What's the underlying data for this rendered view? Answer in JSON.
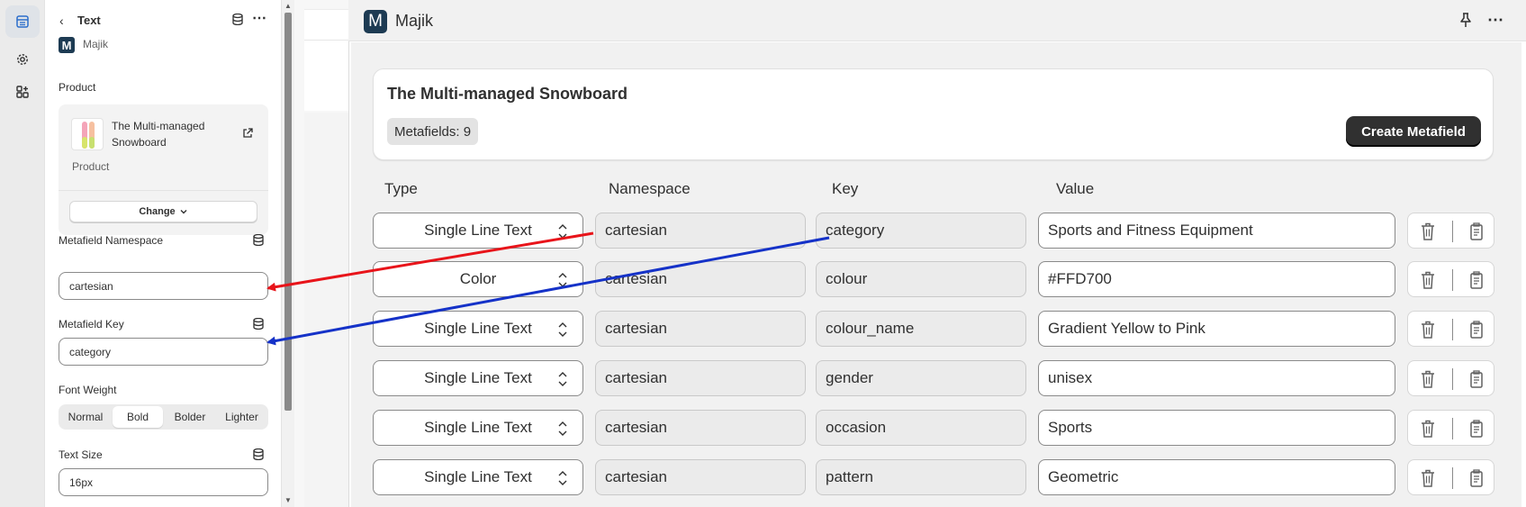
{
  "panel": {
    "back_glyph": "‹",
    "title": "Text",
    "app_logo_letter": "M",
    "app_name": "Majik",
    "product_label": "Product",
    "product_name": "The Multi-managed Snowboard",
    "product_type": "Product",
    "change_label": "Change",
    "namespace_label": "Metafield Namespace",
    "namespace_value": "cartesian",
    "key_label": "Metafield Key",
    "key_value": "category",
    "font_weight_label": "Font Weight",
    "font_weights": [
      "Normal",
      "Bold",
      "Bolder",
      "Lighter"
    ],
    "font_weight_selected": "Bold",
    "text_size_label": "Text Size",
    "text_size_value": "16px"
  },
  "app": {
    "logo_letter": "M",
    "name": "Majik",
    "card_title": "The Multi-managed Snowboard",
    "metafields_badge": "Metafields: 9",
    "create_button": "Create Metafield",
    "columns": [
      "Type",
      "Namespace",
      "Key",
      "Value"
    ],
    "rows": [
      {
        "type": "Single Line Text",
        "namespace": "cartesian",
        "key": "category",
        "value": "Sports and Fitness Equipment"
      },
      {
        "type": "Color",
        "namespace": "cartesian",
        "key": "colour",
        "value": "#FFD700"
      },
      {
        "type": "Single Line Text",
        "namespace": "cartesian",
        "key": "colour_name",
        "value": "Gradient Yellow to Pink"
      },
      {
        "type": "Single Line Text",
        "namespace": "cartesian",
        "key": "gender",
        "value": "unisex"
      },
      {
        "type": "Single Line Text",
        "namespace": "cartesian",
        "key": "occasion",
        "value": "Sports"
      },
      {
        "type": "Single Line Text",
        "namespace": "cartesian",
        "key": "pattern",
        "value": "Geometric"
      }
    ]
  },
  "annotations": {
    "namespace_arrow_color": "#e8141a",
    "key_arrow_color": "#1532c8"
  },
  "icons": {
    "rail": [
      "layout-icon",
      "gear-icon",
      "apps-add-icon"
    ],
    "header": [
      "pin-icon",
      "more-icon"
    ],
    "row_actions": [
      "trash-icon",
      "clipboard-icon"
    ]
  }
}
